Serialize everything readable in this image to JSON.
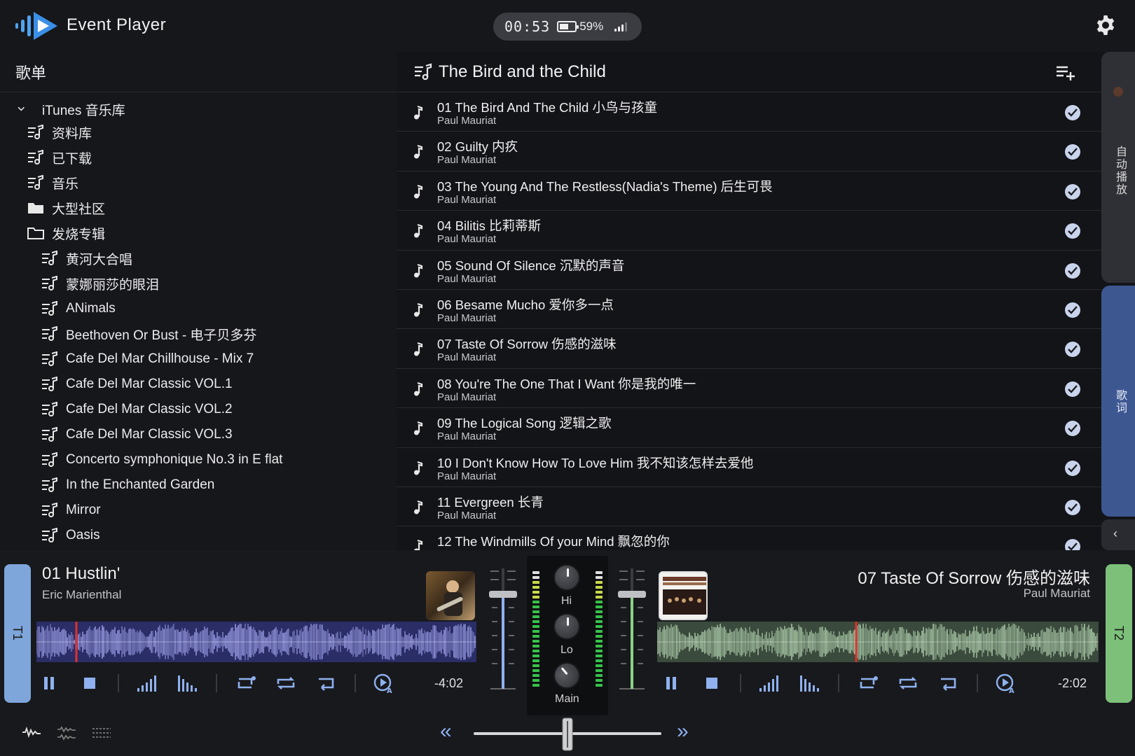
{
  "app": {
    "title": "Event Player"
  },
  "status": {
    "time": "00:53",
    "battery_pct": "59%",
    "battery_level": 0.59
  },
  "sidebar": {
    "title": "歌单",
    "root": "iTunes 音乐库",
    "items": [
      {
        "label": "资料库",
        "icon": "playlist-icon",
        "indent": 1
      },
      {
        "label": "已下载",
        "icon": "playlist-icon",
        "indent": 1
      },
      {
        "label": "音乐",
        "icon": "playlist-icon",
        "indent": 1
      },
      {
        "label": "大型社区",
        "icon": "folder-filled-icon",
        "indent": 1
      },
      {
        "label": "发烧专辑",
        "icon": "folder-open-icon",
        "indent": 1
      },
      {
        "label": "黄河大合唱",
        "icon": "playlist-icon",
        "indent": 2
      },
      {
        "label": "蒙娜丽莎的眼泪",
        "icon": "playlist-icon",
        "indent": 2
      },
      {
        "label": "ANimals",
        "icon": "playlist-icon",
        "indent": 2
      },
      {
        "label": "Beethoven Or Bust - 电子贝多芬",
        "icon": "playlist-icon",
        "indent": 2
      },
      {
        "label": "Cafe Del Mar Chillhouse - Mix 7",
        "icon": "playlist-icon",
        "indent": 2
      },
      {
        "label": "Cafe Del Mar Classic VOL.1",
        "icon": "playlist-icon",
        "indent": 2
      },
      {
        "label": "Cafe Del Mar Classic VOL.2",
        "icon": "playlist-icon",
        "indent": 2
      },
      {
        "label": "Cafe Del Mar Classic VOL.3",
        "icon": "playlist-icon",
        "indent": 2
      },
      {
        "label": "Concerto symphonique No.3 in E flat",
        "icon": "playlist-icon",
        "indent": 2
      },
      {
        "label": "In the Enchanted Garden",
        "icon": "playlist-icon",
        "indent": 2
      },
      {
        "label": "Mirror",
        "icon": "playlist-icon",
        "indent": 2
      },
      {
        "label": "Oasis",
        "icon": "playlist-icon",
        "indent": 2
      }
    ]
  },
  "playlist": {
    "title": "The Bird and the Child",
    "tracks": [
      {
        "name": "01 The Bird And The Child 小鸟与孩童",
        "artist": "Paul Mauriat"
      },
      {
        "name": "02 Guilty 内疚",
        "artist": "Paul Mauriat"
      },
      {
        "name": "03 The Young And The Restless(Nadia's Theme) 后生可畏",
        "artist": "Paul Mauriat"
      },
      {
        "name": "04 Bilitis 比莉蒂斯",
        "artist": "Paul Mauriat"
      },
      {
        "name": "05 Sound Of Silence 沉默的声音",
        "artist": "Paul Mauriat"
      },
      {
        "name": "06 Besame Mucho 爱你多一点",
        "artist": "Paul Mauriat"
      },
      {
        "name": "07 Taste Of Sorrow 伤感的滋味",
        "artist": "Paul Mauriat"
      },
      {
        "name": "08 You're The One That I Want 你是我的唯一",
        "artist": "Paul Mauriat"
      },
      {
        "name": "09 The Logical Song 逻辑之歌",
        "artist": "Paul Mauriat"
      },
      {
        "name": "10 I Don't Know How To Love Him 我不知该怎样去爱他",
        "artist": "Paul Mauriat"
      },
      {
        "name": "11 Evergreen 长青",
        "artist": "Paul Mauriat"
      },
      {
        "name": "12 The Windmills Of your Mind 飘忽的你",
        "artist": ""
      }
    ]
  },
  "side_tabs": {
    "autoplay": "自动播放",
    "lyrics": "歌词"
  },
  "deck1": {
    "tab": "T1",
    "title": "01 Hustlin'",
    "artist": "Eric Marienthal",
    "remaining": "-4:02",
    "progress": 0.09,
    "color": "#8fb1ef"
  },
  "deck2": {
    "tab": "T2",
    "title": "07 Taste Of Sorrow 伤感的滋味",
    "artist": "Paul Mauriat",
    "remaining": "-2:02",
    "progress": 0.45,
    "color": "#8ed08a"
  },
  "mixer": {
    "hi_label": "Hi",
    "lo_label": "Lo",
    "main_label": "Main",
    "crossfader": 0.5
  },
  "colors": {
    "accent_blue": "#8fb1ef",
    "accent_green": "#8ed08a",
    "tab_blue": "#3d5791"
  }
}
